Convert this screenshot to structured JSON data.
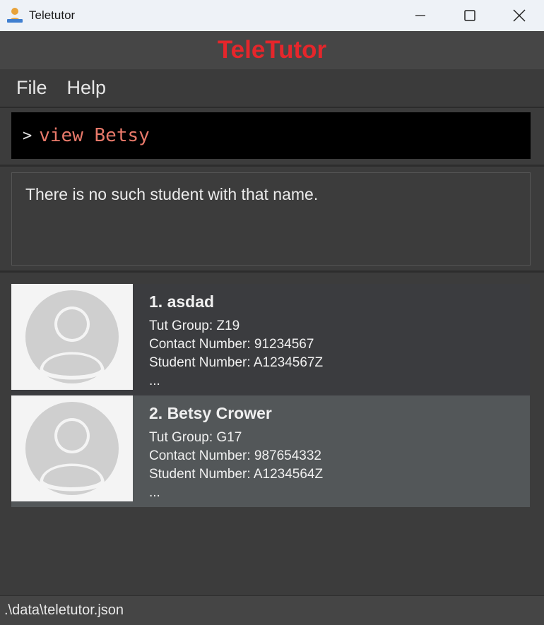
{
  "window": {
    "title": "Teletutor"
  },
  "header": {
    "app_title": "TeleTutor"
  },
  "menu": {
    "items": [
      {
        "label": "File"
      },
      {
        "label": "Help"
      }
    ]
  },
  "command": {
    "prompt": ">",
    "value": "view Betsy"
  },
  "result": {
    "message": "There is no such student with that name."
  },
  "students": [
    {
      "index_name": "1. asdad",
      "tut_group": "Tut Group: Z19",
      "contact": "Contact Number: 91234567",
      "student_number": "Student Number: A1234567Z",
      "more": "..."
    },
    {
      "index_name": "2. Betsy Crower",
      "tut_group": "Tut Group: G17",
      "contact": "Contact Number: 987654332",
      "student_number": "Student Number: A1234564Z",
      "more": "..."
    }
  ],
  "status": {
    "path": ".\\data\\teletutor.json"
  },
  "colors": {
    "accent": "#e5262b",
    "command_text": "#e8796a",
    "selected_card": "#535759"
  }
}
